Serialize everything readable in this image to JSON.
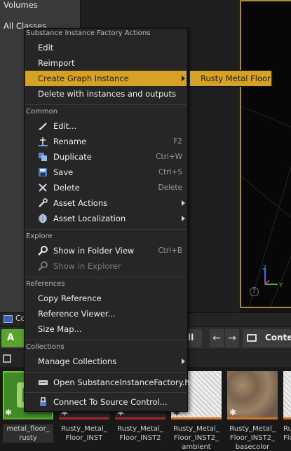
{
  "modes_panel": {
    "items": [
      "Volumes",
      "All Classes"
    ]
  },
  "content_browser": {
    "tab_label": "Co",
    "add_label": "A",
    "import_label": "ll",
    "path_label": "Conte",
    "nav_back": "←",
    "nav_forward": "→",
    "assets": [
      {
        "name": "metal_floor_\nrusty",
        "bar_color": "#5aa32e",
        "thumb": "green"
      },
      {
        "name": "Rusty_Metal_\nFloor_INST",
        "bar_color": "#a8262f",
        "thumb": "dark"
      },
      {
        "name": "Rusty_Metal_\nFloor_INST2",
        "bar_color": "#a8262f",
        "thumb": "dark"
      },
      {
        "name": "Rusty_Metal_\nFloor_INST2_\nambient",
        "bar_color": "#d8731f",
        "thumb": "white"
      },
      {
        "name": "Rusty_Metal_\nFloor_INST2_\nbasecolor",
        "bar_color": "#d8731f",
        "thumb": "rust"
      },
      {
        "name": "Ru\nFlo",
        "bar_color": "#d8731f",
        "thumb": "white"
      }
    ]
  },
  "viewport": {
    "axis_z": "Z",
    "axis_y": "Y",
    "help": "?"
  },
  "context_menu": {
    "sections": {
      "factory": "Substance Instance Factory Actions",
      "common": "Common",
      "explore": "Explore",
      "references": "References",
      "collections": "Collections"
    },
    "factory_items": {
      "edit": "Edit",
      "reimport": "Reimport",
      "create_graph_instance": "Create Graph Instance",
      "delete_with_instances": "Delete with instances and outputs"
    },
    "common_items": {
      "edit": "Edit...",
      "rename": "Rename",
      "rename_key": "F2",
      "duplicate": "Duplicate",
      "duplicate_key": "Ctrl+W",
      "save": "Save",
      "save_key": "Ctrl+S",
      "delete": "Delete",
      "delete_key": "Delete",
      "asset_actions": "Asset Actions",
      "asset_localization": "Asset Localization"
    },
    "explore_items": {
      "show_in_folder": "Show in Folder View",
      "show_in_folder_key": "Ctrl+B",
      "show_in_explorer": "Show in Explorer"
    },
    "reference_items": {
      "copy_reference": "Copy Reference",
      "reference_viewer": "Reference Viewer...",
      "size_map": "Size Map..."
    },
    "collection_items": {
      "manage": "Manage Collections"
    },
    "bottom_items": {
      "open_header": "Open SubstanceInstanceFactory.h",
      "connect_source_control": "Connect To Source Control..."
    },
    "submenu": {
      "item": "Rusty Metal Floor"
    }
  }
}
